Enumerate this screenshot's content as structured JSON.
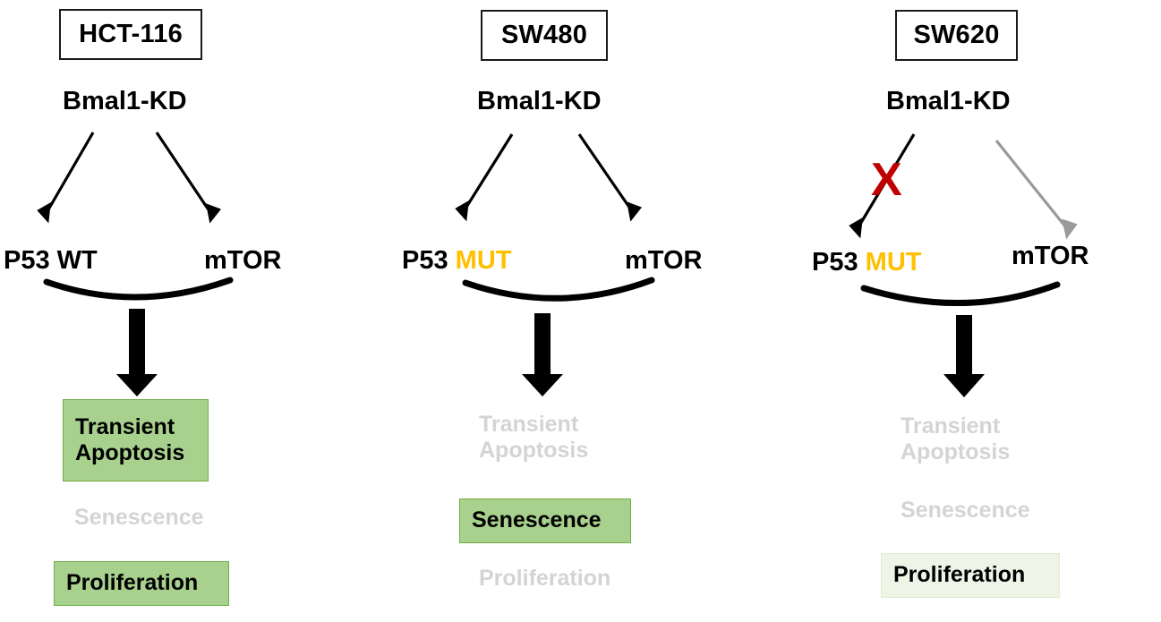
{
  "figure": {
    "type": "schematic-diagram",
    "description": "Three-panel schematic of Bmal1 knockdown signalling outcomes in colorectal cancer cell lines",
    "background_color": "#ffffff",
    "colors": {
      "active_box_fill": "#a9d18e",
      "active_box_border": "#70ad47",
      "pale_box_fill": "#eef5e6",
      "pale_box_border": "#dfeccf",
      "inactive_text": "#d4d4d4",
      "mutation_text": "#ffc000",
      "blocked_marker": "#c00000",
      "arrow_black": "#000000",
      "arrow_gray": "#9a9a9a",
      "title_border": "#1a1a1a"
    }
  },
  "panels": [
    {
      "id": "hct-116",
      "title": "HCT-116",
      "upstream": "Bmal1-KD",
      "targets": {
        "left": {
          "name": "P53",
          "state": "WT",
          "state_highlighted": false
        },
        "right": {
          "name": "mTOR"
        }
      },
      "arrows": {
        "left": {
          "color": "#000000",
          "blocked": false
        },
        "right": {
          "color": "#000000",
          "blocked": false
        }
      },
      "outcomes": [
        {
          "label": "Transient\nApoptosis",
          "active": true,
          "style": "filled"
        },
        {
          "label": "Senescence",
          "active": false,
          "style": "none"
        },
        {
          "label": "Proliferation",
          "active": true,
          "style": "filled"
        }
      ]
    },
    {
      "id": "sw480",
      "title": "SW480",
      "upstream": "Bmal1-KD",
      "targets": {
        "left": {
          "name": "P53",
          "state": "MUT",
          "state_highlighted": true
        },
        "right": {
          "name": "mTOR"
        }
      },
      "arrows": {
        "left": {
          "color": "#000000",
          "blocked": false
        },
        "right": {
          "color": "#000000",
          "blocked": false
        }
      },
      "outcomes": [
        {
          "label": "Transient\nApoptosis",
          "active": false,
          "style": "none"
        },
        {
          "label": "Senescence",
          "active": true,
          "style": "filled"
        },
        {
          "label": "Proliferation",
          "active": false,
          "style": "none"
        }
      ]
    },
    {
      "id": "sw620",
      "title": "SW620",
      "upstream": "Bmal1-KD",
      "targets": {
        "left": {
          "name": "P53",
          "state": "MUT",
          "state_highlighted": true
        },
        "right": {
          "name": "mTOR"
        }
      },
      "arrows": {
        "left": {
          "color": "#000000",
          "blocked": true,
          "block_marker": "X"
        },
        "right": {
          "color": "#9a9a9a",
          "blocked": false
        }
      },
      "outcomes": [
        {
          "label": "Transient\nApoptosis",
          "active": false,
          "style": "none"
        },
        {
          "label": "Senescence",
          "active": false,
          "style": "none"
        },
        {
          "label": "Proliferation",
          "active": true,
          "style": "pale"
        }
      ]
    }
  ],
  "labels": {
    "p1_title": "HCT-116",
    "p1_upstream": "Bmal1-KD",
    "p1_left_name": "P53 ",
    "p1_left_state": "WT",
    "p1_right": "mTOR",
    "p1_out1": "Transient\nApoptosis",
    "p1_out2": "Senescence",
    "p1_out3": "Proliferation",
    "p2_title": "SW480",
    "p2_upstream": "Bmal1-KD",
    "p2_left_name": "P53 ",
    "p2_left_state": "MUT",
    "p2_right": "mTOR",
    "p2_out1": "Transient\nApoptosis",
    "p2_out2": "Senescence",
    "p2_out3": "Proliferation",
    "p3_title": "SW620",
    "p3_upstream": "Bmal1-KD",
    "p3_left_name": "P53 ",
    "p3_left_state": "MUT",
    "p3_right": "mTOR",
    "p3_block_marker": "X",
    "p3_out1": "Transient\nApoptosis",
    "p3_out2": "Senescence",
    "p3_out3": "Proliferation"
  }
}
